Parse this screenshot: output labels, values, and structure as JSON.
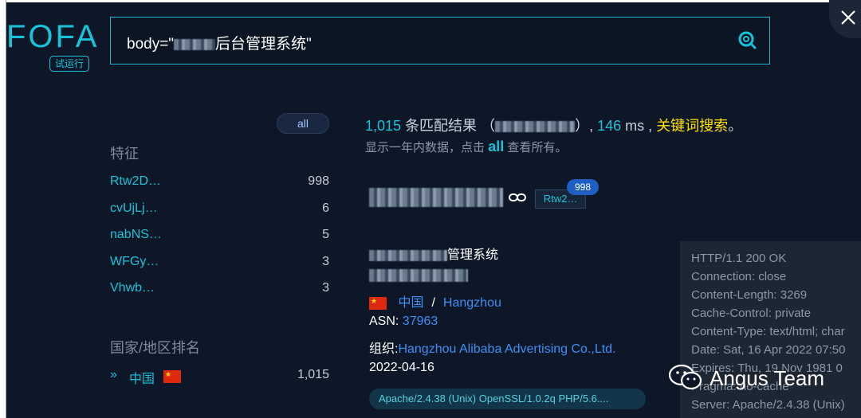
{
  "logo": {
    "text": "FOFA",
    "trial_badge": "试运行"
  },
  "search": {
    "query_prefix": "body=\"",
    "query_suffix": "后台管理系统\""
  },
  "sidebar": {
    "all_pill": "all",
    "features_title": "特征",
    "features": [
      {
        "name": "Rtw2D…",
        "count": "998"
      },
      {
        "name": "cvUjLj…",
        "count": "6"
      },
      {
        "name": "nabNS…",
        "count": "5"
      },
      {
        "name": "WFGy…",
        "count": "3"
      },
      {
        "name": "Vhwb…",
        "count": "3"
      }
    ],
    "country_title": "国家/地区排名",
    "country": {
      "chevron": "»",
      "name": "中国",
      "count": "1,015"
    }
  },
  "summary": {
    "count": "1,015",
    "matches_text": "条匹配结果",
    "paren_open": "（",
    "paren_close": "）,",
    "time": "146",
    "time_unit": "ms ,",
    "keyword_search": "关键词搜索",
    "period": "。",
    "sub_prefix": "显示一年内数据，点击",
    "sub_all": "all",
    "sub_suffix": "查看所有。"
  },
  "result": {
    "tag": "Rtw2…",
    "badge": "998",
    "title_suffix": "管理系统",
    "country": "中国",
    "geo_sep": "/",
    "city": "Hangzhou",
    "asn_label": "ASN:",
    "asn": "37963",
    "org_label": "组织:",
    "org": "Hangzhou Alibaba Advertising Co.,Ltd.",
    "date": "2022-04-16",
    "server": "Apache/2.4.38 (Unix) OpenSSL/1.0.2q PHP/5.6...."
  },
  "headers": [
    "HTTP/1.1 200 OK",
    "Connection: close",
    "Content-Length: 3269",
    "Cache-Control: private",
    "Content-Type: text/html; char",
    "Date: Sat, 16 Apr 2022 07:50",
    "Expires: Thu, 19 Nov 1981 0",
    "Pragma: no-cache",
    "Server: Apache/2.4.38 (Unix)"
  ],
  "watermark": {
    "text": "Angus Team"
  },
  "colors": {
    "accent": "#19c2d9",
    "link": "#3f8ef5",
    "keyword": "#ffe100",
    "background": "#0d1727"
  }
}
